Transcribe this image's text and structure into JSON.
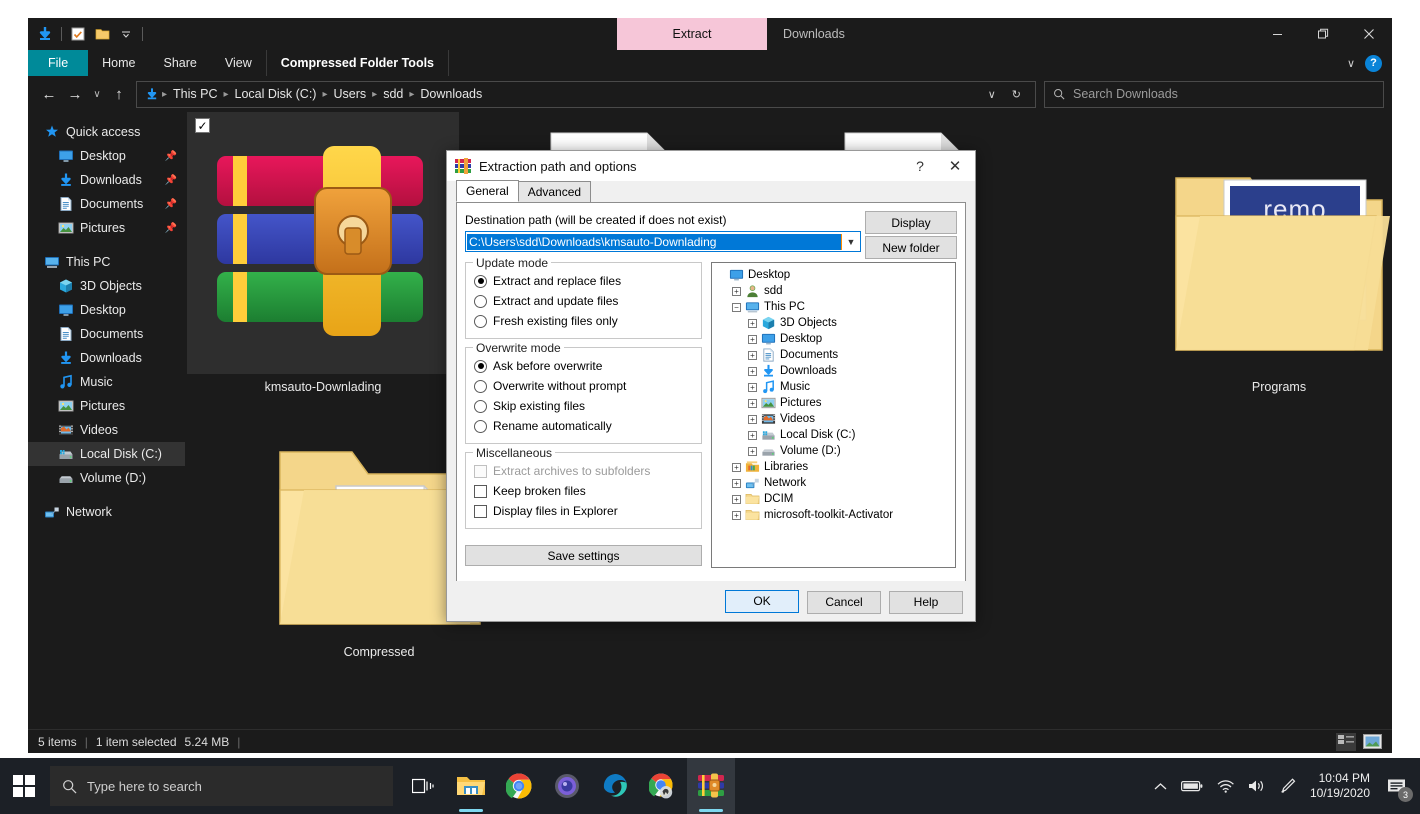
{
  "explorer": {
    "window_title": "Downloads",
    "quick_access_toolbar": [
      {
        "name": "downloads-icon",
        "glyph": "⬇"
      },
      {
        "name": "properties-icon",
        "glyph": "☑"
      },
      {
        "name": "new-folder-icon",
        "glyph": "📁"
      },
      {
        "name": "customize-chevron-icon",
        "glyph": "▾"
      }
    ],
    "contextual_tab": "Extract",
    "ribbon_tabs": [
      "File",
      "Home",
      "Share",
      "View"
    ],
    "contextual_group_tab": "Compressed Folder Tools",
    "window_controls": {
      "minimize": "—",
      "maximize": "❐",
      "close": "✕"
    },
    "ribbon_collapse": "∨",
    "help_button": "?",
    "address": {
      "back": "←",
      "forward": "→",
      "recent": "∨",
      "up": "↑",
      "breadcrumbs": [
        "This PC",
        "Local Disk (C:)",
        "Users",
        "sdd",
        "Downloads"
      ],
      "dropdown": "∨",
      "refresh": "↻"
    },
    "search": {
      "placeholder": "Search Downloads",
      "icon": "search-icon"
    },
    "nav_pane": [
      {
        "label": "Quick access",
        "icon": "star",
        "indent": 0,
        "pin": false,
        "selected": false
      },
      {
        "label": "Desktop",
        "icon": "desktop",
        "indent": 1,
        "pin": true,
        "selected": false
      },
      {
        "label": "Downloads",
        "icon": "downloads",
        "indent": 1,
        "pin": true,
        "selected": false
      },
      {
        "label": "Documents",
        "icon": "documents",
        "indent": 1,
        "pin": true,
        "selected": false
      },
      {
        "label": "Pictures",
        "icon": "pictures",
        "indent": 1,
        "pin": true,
        "selected": false
      },
      {
        "label": "This PC",
        "icon": "pc",
        "indent": 0,
        "pin": false,
        "selected": false
      },
      {
        "label": "3D Objects",
        "icon": "objects3d",
        "indent": 1,
        "pin": false,
        "selected": false
      },
      {
        "label": "Desktop",
        "icon": "desktop",
        "indent": 1,
        "pin": false,
        "selected": false
      },
      {
        "label": "Documents",
        "icon": "documents",
        "indent": 1,
        "pin": false,
        "selected": false
      },
      {
        "label": "Downloads",
        "icon": "downloads",
        "indent": 1,
        "pin": false,
        "selected": false
      },
      {
        "label": "Music",
        "icon": "music",
        "indent": 1,
        "pin": false,
        "selected": false
      },
      {
        "label": "Pictures",
        "icon": "pictures",
        "indent": 1,
        "pin": false,
        "selected": false
      },
      {
        "label": "Videos",
        "icon": "videos",
        "indent": 1,
        "pin": false,
        "selected": false
      },
      {
        "label": "Local Disk (C:)",
        "icon": "disk",
        "indent": 1,
        "pin": false,
        "selected": true
      },
      {
        "label": "Volume (D:)",
        "icon": "drive",
        "indent": 1,
        "pin": false,
        "selected": false
      },
      {
        "label": "Network",
        "icon": "network",
        "indent": 0,
        "pin": false,
        "selected": false
      }
    ],
    "files": [
      {
        "name": "kmsauto-Downlading",
        "type": "archive",
        "selected": true
      },
      {
        "name": "Compressed",
        "type": "folder-docs",
        "selected": false
      },
      {
        "name": "Programs",
        "type": "folder-remo",
        "selected": false
      }
    ],
    "status": {
      "item_count": "5 items",
      "selection": "1 item selected",
      "size": "5.24 MB",
      "view_details": "details-view-icon",
      "view_large": "large-icons-view-icon"
    }
  },
  "dialog": {
    "title": "Extraction path and options",
    "help_btn": "?",
    "close_btn": "✕",
    "tabs": [
      {
        "label": "General",
        "active": true
      },
      {
        "label": "Advanced",
        "active": false
      }
    ],
    "destination_label": "Destination path (will be created if does not exist)",
    "destination_value": "C:\\Users\\sdd\\Downloads\\kmsauto-Downlading",
    "display_button": "Display",
    "new_folder_button": "New folder",
    "update_mode": {
      "title": "Update mode",
      "options": [
        {
          "label": "Extract and replace files",
          "selected": true
        },
        {
          "label": "Extract and update files",
          "selected": false
        },
        {
          "label": "Fresh existing files only",
          "selected": false
        }
      ]
    },
    "overwrite_mode": {
      "title": "Overwrite mode",
      "options": [
        {
          "label": "Ask before overwrite",
          "selected": true
        },
        {
          "label": "Overwrite without prompt",
          "selected": false
        },
        {
          "label": "Skip existing files",
          "selected": false
        },
        {
          "label": "Rename automatically",
          "selected": false
        }
      ]
    },
    "miscellaneous": {
      "title": "Miscellaneous",
      "options": [
        {
          "label": "Extract archives to subfolders",
          "checked": false,
          "disabled": true
        },
        {
          "label": "Keep broken files",
          "checked": false,
          "disabled": false
        },
        {
          "label": "Display files in Explorer",
          "checked": false,
          "disabled": false
        }
      ]
    },
    "save_settings_button": "Save settings",
    "tree": [
      {
        "label": "Desktop",
        "indent": 0,
        "expander": "none",
        "icon": "desktop"
      },
      {
        "label": "sdd",
        "indent": 1,
        "expander": "plus",
        "icon": "user"
      },
      {
        "label": "This PC",
        "indent": 1,
        "expander": "minus",
        "icon": "pc"
      },
      {
        "label": "3D Objects",
        "indent": 2,
        "expander": "plus",
        "icon": "objects3d"
      },
      {
        "label": "Desktop",
        "indent": 2,
        "expander": "plus",
        "icon": "desktop"
      },
      {
        "label": "Documents",
        "indent": 2,
        "expander": "plus",
        "icon": "documents"
      },
      {
        "label": "Downloads",
        "indent": 2,
        "expander": "plus",
        "icon": "downloads"
      },
      {
        "label": "Music",
        "indent": 2,
        "expander": "plus",
        "icon": "music"
      },
      {
        "label": "Pictures",
        "indent": 2,
        "expander": "plus",
        "icon": "pictures"
      },
      {
        "label": "Videos",
        "indent": 2,
        "expander": "plus",
        "icon": "videos"
      },
      {
        "label": "Local Disk (C:)",
        "indent": 2,
        "expander": "plus",
        "icon": "disk"
      },
      {
        "label": "Volume (D:)",
        "indent": 2,
        "expander": "plus",
        "icon": "drive"
      },
      {
        "label": "Libraries",
        "indent": 1,
        "expander": "plus",
        "icon": "libraries"
      },
      {
        "label": "Network",
        "indent": 1,
        "expander": "plus",
        "icon": "network"
      },
      {
        "label": "DCIM",
        "indent": 1,
        "expander": "plus",
        "icon": "folder"
      },
      {
        "label": "microsoft-toolkit-Activator",
        "indent": 1,
        "expander": "plus",
        "icon": "folder"
      }
    ],
    "ok_button": "OK",
    "cancel_button": "Cancel",
    "help_footer_button": "Help"
  },
  "taskbar": {
    "start": "start-button",
    "search_placeholder": "Type here to search",
    "apps": [
      {
        "name": "task-view-icon",
        "active": false,
        "underline": false
      },
      {
        "name": "file-explorer-icon",
        "active": false,
        "underline": true
      },
      {
        "name": "google-chrome-icon",
        "active": false,
        "underline": false
      },
      {
        "name": "media-player-icon",
        "active": false,
        "underline": false
      },
      {
        "name": "microsoft-edge-icon",
        "active": false,
        "underline": false
      },
      {
        "name": "chrome-update-icon",
        "active": false,
        "underline": true
      },
      {
        "name": "winrar-icon",
        "active": true,
        "underline": true
      }
    ],
    "tray": {
      "show_hidden": "∧",
      "battery": "battery-icon",
      "wifi": "wifi-icon",
      "volume": "volume-icon",
      "pen": "pen-icon",
      "time": "10:04 PM",
      "date": "10/19/2020",
      "notification_count": "3"
    }
  },
  "colors": {
    "accent": "#0078d7",
    "extract_tab": "#f6c6d8",
    "file_tab": "#008a99",
    "explorer_bg": "#1b1b1b",
    "taskbar": "#1c2026"
  }
}
